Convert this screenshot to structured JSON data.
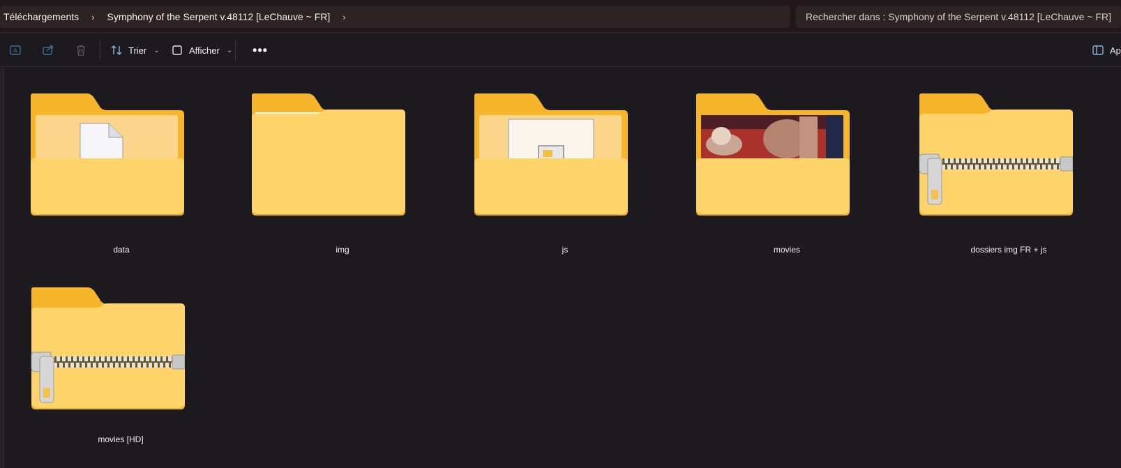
{
  "breadcrumb": {
    "items": [
      "Téléchargements",
      "Symphony of the Serpent v.48112 [LeChauve ~ FR]"
    ],
    "separator": ">"
  },
  "search": {
    "placeholder": "Rechercher dans : Symphony of the Serpent v.48112 [LeChauve ~ FR]"
  },
  "toolbar": {
    "sort_label": "Trier",
    "view_label": "Afficher",
    "more_label": "•••",
    "preview_label": "Aperçu"
  },
  "folders": [
    {
      "name": "data",
      "type": "folder-with-document"
    },
    {
      "name": "img",
      "type": "folder-empty-page"
    },
    {
      "name": "js",
      "type": "folder-with-file-thumbnail"
    },
    {
      "name": "movies",
      "type": "folder-with-image-thumbnail"
    },
    {
      "name": "dossiers img FR + js",
      "type": "zip-folder"
    },
    {
      "name": "movies [HD]",
      "type": "zip-folder"
    }
  ],
  "colors": {
    "background": "#1c1a1e",
    "addressbar": "#1f1719",
    "field": "#2d2224",
    "folder_back": "#f5b628",
    "folder_front": "#ffd66e"
  }
}
